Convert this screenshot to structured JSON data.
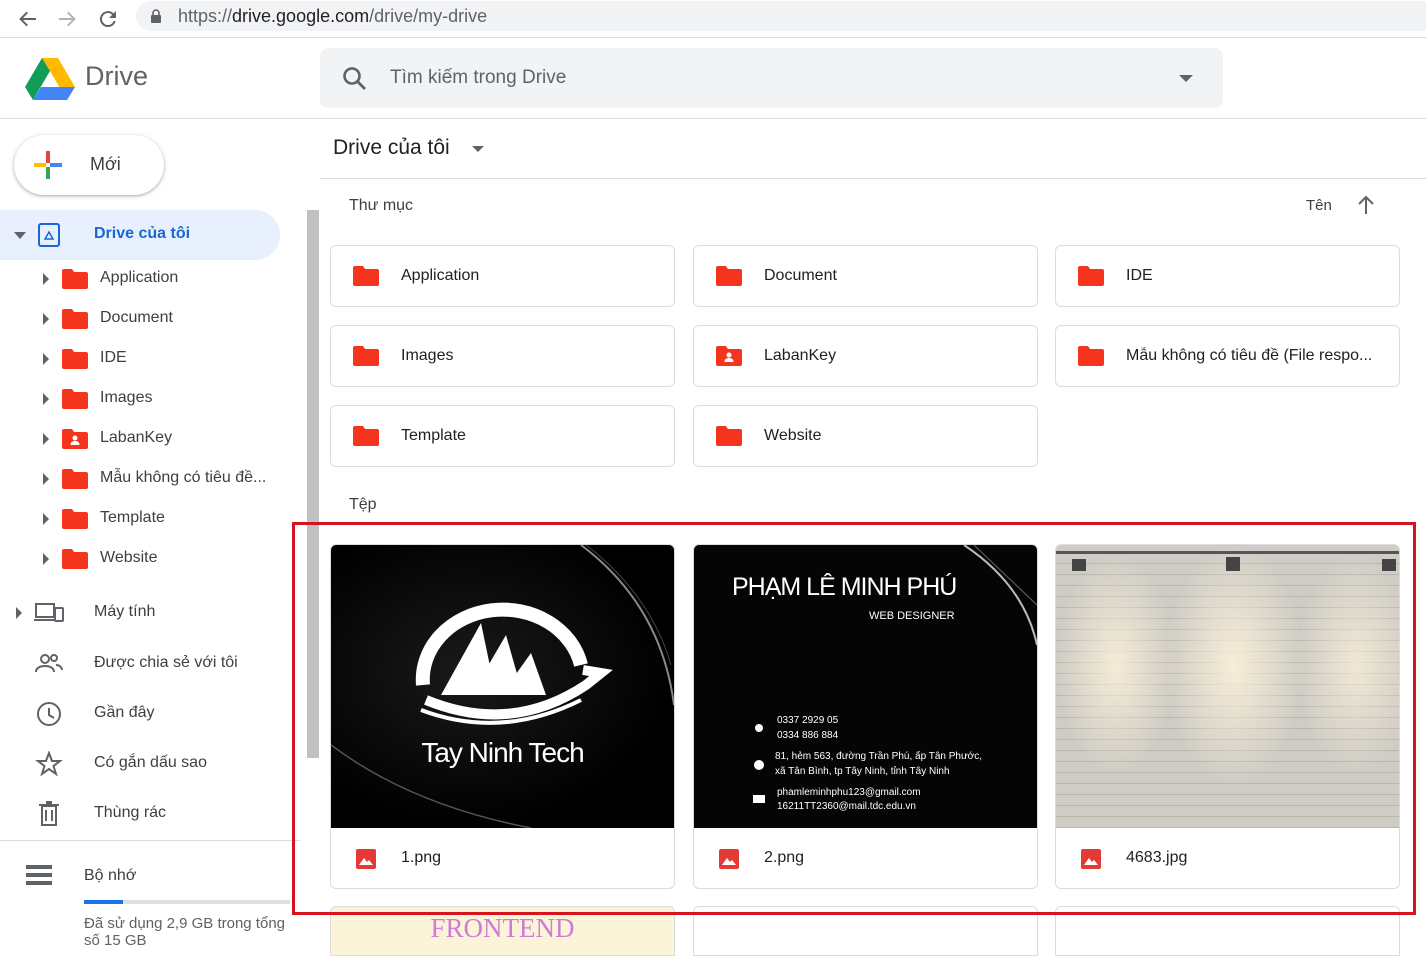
{
  "browser": {
    "url_prefix": "https://",
    "url_host": "drive.google.com",
    "url_path": "/drive/my-drive"
  },
  "header": {
    "app_name": "Drive",
    "search_placeholder": "Tìm kiếm trong Drive"
  },
  "sidebar": {
    "new_label": "Mới",
    "my_drive_label": "Drive của tôi",
    "tree": [
      {
        "label": "Application",
        "shared": false
      },
      {
        "label": "Document",
        "shared": false
      },
      {
        "label": "IDE",
        "shared": false
      },
      {
        "label": "Images",
        "shared": false
      },
      {
        "label": "LabanKey",
        "shared": true
      },
      {
        "label": "Mẫu không có tiêu đề...",
        "shared": false
      },
      {
        "label": "Template",
        "shared": false
      },
      {
        "label": "Website",
        "shared": false
      }
    ],
    "nav": {
      "computers": "Máy tính",
      "shared": "Được chia sẻ với tôi",
      "recent": "Gần đây",
      "starred": "Có gắn dấu sao",
      "trash": "Thùng rác"
    },
    "storage": {
      "label": "Bộ nhớ",
      "usage_text": "Đã sử dụng 2,9 GB trong tổng số 15 GB",
      "used_fraction": 0.19
    }
  },
  "main": {
    "breadcrumb": "Drive của tôi",
    "folders_header": "Thư mục",
    "sort_label": "Tên",
    "files_header": "Tệp",
    "folders": [
      {
        "name": "Application",
        "shared": false
      },
      {
        "name": "Document",
        "shared": false
      },
      {
        "name": "IDE",
        "shared": false
      },
      {
        "name": "Images",
        "shared": false
      },
      {
        "name": "LabanKey",
        "shared": true
      },
      {
        "name": "Mẫu không có tiêu đề (File respo...",
        "shared": false
      },
      {
        "name": "Template",
        "shared": false
      },
      {
        "name": "Website",
        "shared": false
      }
    ],
    "files": [
      {
        "name": "1.png",
        "thumb_text": "Tay Ninh Tech"
      },
      {
        "name": "2.png",
        "thumb_name": "PHẠM LÊ MINH PHÚ",
        "thumb_role": "WEB DESIGNER",
        "phone1": "0337 2929 05",
        "phone2": "0334 886 884",
        "addr1": "81, hẻm 563, đường Trần Phú, ấp Tân Phước,",
        "addr2": "xã Tân Bình, tp Tây Ninh, tỉnh Tây Ninh",
        "email1": "phamleminhphu123@gmail.com",
        "email2": "16211TT2360@mail.tdc.edu.vn"
      },
      {
        "name": "4683.jpg"
      }
    ],
    "peek_text": "FRONTEND"
  },
  "colors": {
    "folder_red": "#f4341d",
    "accent_blue": "#1967d2",
    "highlight_red": "#d5141f"
  }
}
